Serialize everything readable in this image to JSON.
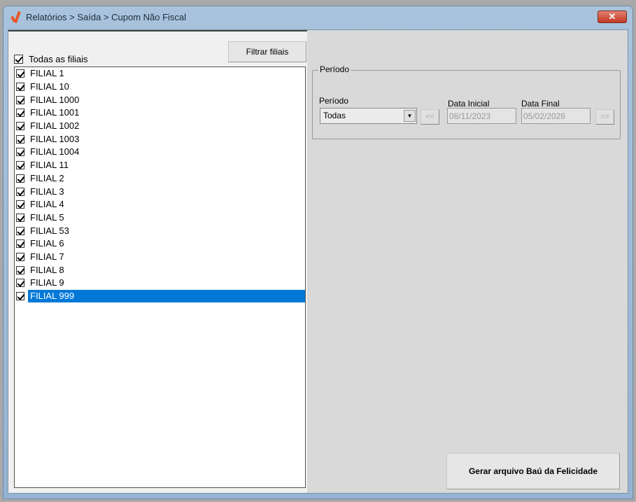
{
  "window": {
    "title": "Relatórios > Saída > Cupom Não Fiscal",
    "close": "✕"
  },
  "left": {
    "all_label": "Todas as filiais",
    "filter_button": "Filtrar filiais",
    "items": [
      "FILIAL 1",
      "FILIAL 10",
      "FILIAL 1000",
      "FILIAL 1001",
      "FILIAL 1002",
      "FILIAL 1003",
      "FILIAL 1004",
      "FILIAL 11",
      "FILIAL 2",
      "FILIAL 3",
      "FILIAL 4",
      "FILIAL 5",
      "FILIAL 53",
      "FILIAL 6",
      "FILIAL 7",
      "FILIAL 8",
      "FILIAL 9",
      "FILIAL 999"
    ],
    "selected_index": 17
  },
  "periodo": {
    "group_label": "Período",
    "select_label": "Período",
    "select_value": "Todas",
    "prev": "<<",
    "next": ">>",
    "start_label": "Data Inicial",
    "start_value": "08/11/2023",
    "end_label": "Data Final",
    "end_value": "05/02/2026"
  },
  "generate_button": "Gerar arquivo Baú da Felicidade"
}
